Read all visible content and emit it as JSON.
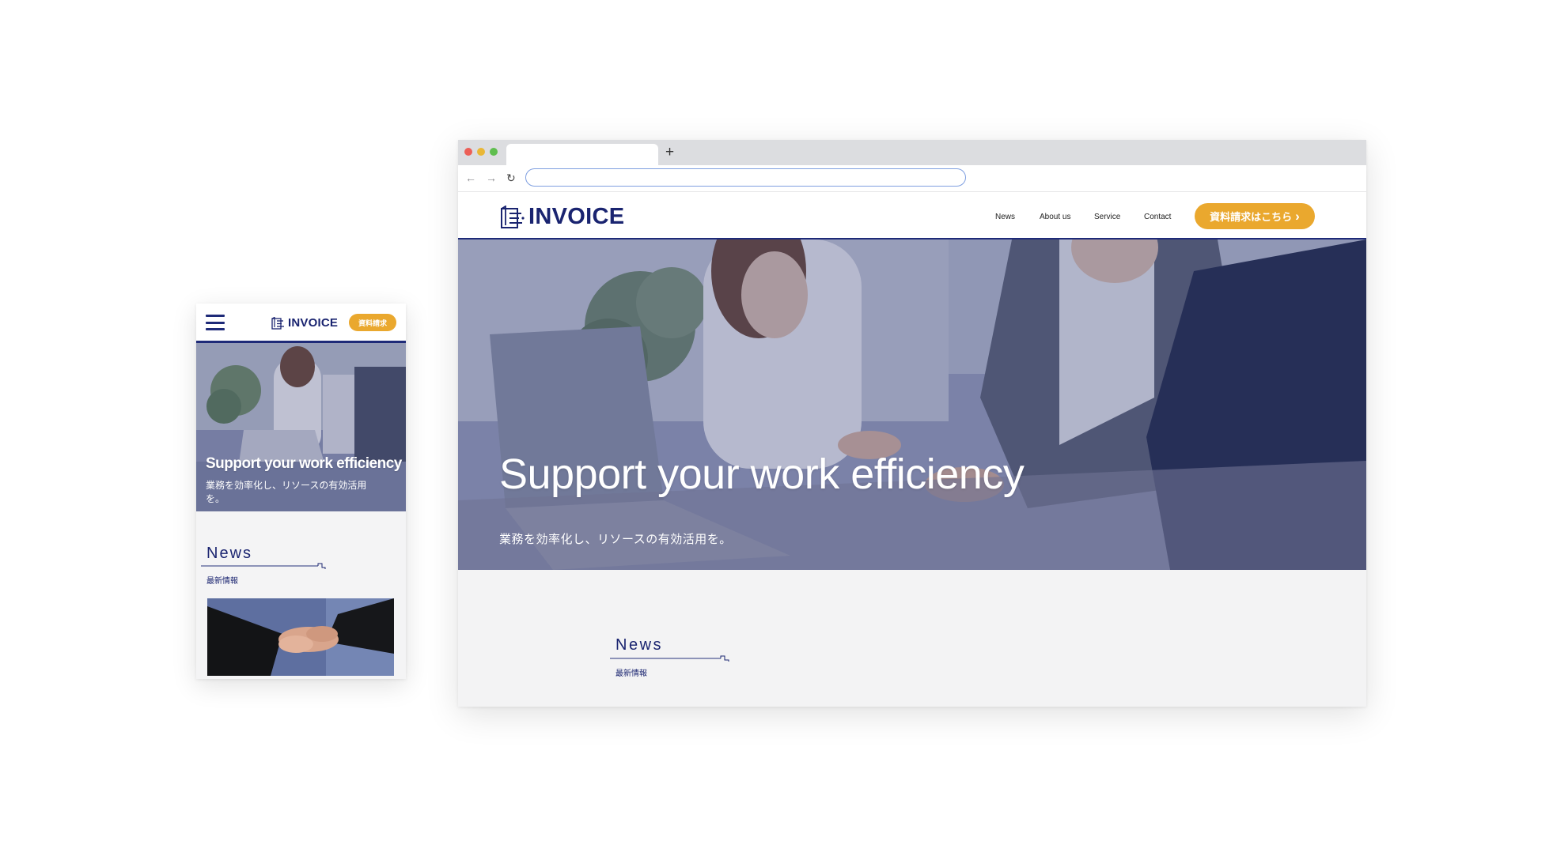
{
  "brand": {
    "name": "INVOICE",
    "primary_color": "#1a2470",
    "accent_color": "#eaa82e",
    "logo_icon": "document-list-icon"
  },
  "mobile": {
    "menu_icon": "hamburger-menu-icon",
    "cta_label": "資料請求",
    "hero": {
      "title": "Support your work efficiency",
      "subtitle": "業務を効率化し、リソースの有効活用を。"
    },
    "news": {
      "title": "News",
      "subtitle": "最新情報"
    },
    "news_image": "handshake-photo"
  },
  "browser": {
    "window_controls": [
      "close",
      "minimize",
      "maximize"
    ],
    "new_tab_label": "+",
    "nav_icons": [
      "back-arrow-icon",
      "forward-arrow-icon",
      "reload-icon"
    ],
    "back_glyph": "←",
    "forward_glyph": "→",
    "reload_glyph": "↻",
    "address_value": "",
    "site": {
      "nav": [
        "News",
        "About us",
        "Service",
        "Contact"
      ],
      "cta_label": "資料請求はこちら",
      "cta_icon": "chevron-right-icon",
      "cta_glyph": "›",
      "hero": {
        "title": "Support your work efficiency",
        "subtitle": "業務を効率化し、リソースの有効活用を。"
      },
      "news": {
        "title": "News",
        "subtitle": "最新情報"
      }
    }
  }
}
